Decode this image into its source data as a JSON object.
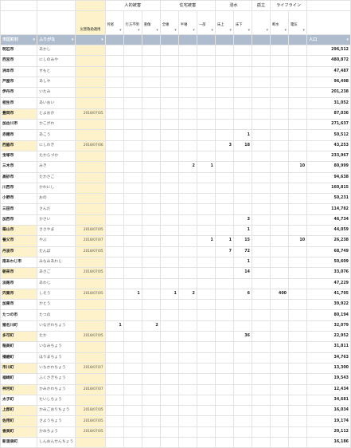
{
  "headers": {
    "groups": [
      "人的被害",
      "住宅被害",
      "浸水",
      "孤立",
      "ライフライン"
    ],
    "sub": [
      "死者",
      "行方不明",
      "重傷",
      "全壊",
      "半壊",
      "一部",
      "床上",
      "床下",
      "",
      "断水",
      "電気"
    ],
    "saigai_label": "災害救助適用",
    "city_col": "市区町村",
    "kana_col": "ふりがな",
    "pop_col": "人口"
  },
  "rows": [
    {
      "city": "明石市",
      "kana": "あかし",
      "date": "",
      "vals": [
        "",
        "",
        "",
        "",
        "",
        "",
        "",
        "",
        "",
        "",
        ""
      ],
      "pop": "296,512"
    },
    {
      "city": "西宮市",
      "kana": "にしのみや",
      "date": "",
      "vals": [
        "",
        "",
        "",
        "",
        "",
        "",
        "",
        "",
        "",
        "",
        ""
      ],
      "pop": "480,872"
    },
    {
      "city": "洲本市",
      "kana": "すもと",
      "date": "",
      "vals": [
        "",
        "",
        "",
        "",
        "",
        "",
        "",
        "",
        "",
        "",
        ""
      ],
      "pop": "47,487"
    },
    {
      "city": "芦屋市",
      "kana": "あしや",
      "date": "",
      "vals": [
        "",
        "",
        "",
        "",
        "",
        "",
        "",
        "",
        "",
        "",
        ""
      ],
      "pop": "96,498"
    },
    {
      "city": "伊丹市",
      "kana": "いたみ",
      "date": "",
      "vals": [
        "",
        "",
        "",
        "",
        "",
        "",
        "",
        "",
        "",
        "",
        ""
      ],
      "pop": "201,238"
    },
    {
      "city": "相生市",
      "kana": "あいおい",
      "date": "",
      "vals": [
        "",
        "",
        "",
        "",
        "",
        "",
        "",
        "",
        "",
        "",
        ""
      ],
      "pop": "31,052"
    },
    {
      "city": "豊岡市",
      "kana": "とよおか",
      "date": "2018/07/05",
      "vals": [
        "",
        "",
        "",
        "",
        "",
        "",
        "",
        "",
        "",
        "",
        ""
      ],
      "pop": "87,036"
    },
    {
      "city": "加古川市",
      "kana": "かこがわ",
      "date": "",
      "vals": [
        "",
        "",
        "",
        "",
        "",
        "",
        "",
        "",
        "",
        "",
        ""
      ],
      "pop": "271,637"
    },
    {
      "city": "赤穂市",
      "kana": "あこう",
      "date": "",
      "vals": [
        "",
        "",
        "",
        "",
        "",
        "",
        "",
        "1",
        "",
        "",
        ""
      ],
      "pop": "50,512"
    },
    {
      "city": "西脇市",
      "kana": "にしわき",
      "date": "2018/07/06",
      "vals": [
        "",
        "",
        "",
        "",
        "",
        "",
        "3",
        "18",
        "",
        "",
        ""
      ],
      "pop": "43,253"
    },
    {
      "city": "宝塚市",
      "kana": "たからづか",
      "date": "",
      "vals": [
        "",
        "",
        "",
        "",
        "",
        "",
        "",
        "",
        "",
        "",
        ""
      ],
      "pop": "233,967"
    },
    {
      "city": "三木市",
      "kana": "みき",
      "date": "",
      "vals": [
        "",
        "",
        "",
        "",
        "2",
        "1",
        "",
        "",
        "",
        "",
        "10"
      ],
      "pop": "80,999"
    },
    {
      "city": "高砂市",
      "kana": "たかさご",
      "date": "",
      "vals": [
        "",
        "",
        "",
        "",
        "",
        "",
        "",
        "",
        "",
        "",
        ""
      ],
      "pop": "94,638"
    },
    {
      "city": "川西市",
      "kana": "かわにし",
      "date": "",
      "vals": [
        "",
        "",
        "",
        "",
        "",
        "",
        "",
        "",
        "",
        "",
        ""
      ],
      "pop": "160,815"
    },
    {
      "city": "小野市",
      "kana": "おの",
      "date": "",
      "vals": [
        "",
        "",
        "",
        "",
        "",
        "",
        "",
        "",
        "",
        "",
        ""
      ],
      "pop": "50,231"
    },
    {
      "city": "三田市",
      "kana": "さんだ",
      "date": "",
      "vals": [
        "",
        "",
        "",
        "",
        "",
        "",
        "",
        "",
        "",
        "",
        ""
      ],
      "pop": "114,782"
    },
    {
      "city": "加西市",
      "kana": "かさい",
      "date": "",
      "vals": [
        "",
        "",
        "",
        "",
        "",
        "",
        "",
        "3",
        "",
        "",
        ""
      ],
      "pop": "46,734"
    },
    {
      "city": "篠山市",
      "kana": "ささやま",
      "date": "2018/07/05",
      "vals": [
        "",
        "",
        "",
        "",
        "",
        "",
        "",
        "1",
        "",
        "",
        ""
      ],
      "pop": "44,059"
    },
    {
      "city": "養父市",
      "kana": "やぶ",
      "date": "2018/07/07",
      "vals": [
        "",
        "",
        "",
        "",
        "",
        "1",
        "1",
        "15",
        "",
        "",
        "10"
      ],
      "pop": "26,238"
    },
    {
      "city": "丹波市",
      "kana": "たんば",
      "date": "2018/07/05",
      "vals": [
        "",
        "",
        "",
        "",
        "",
        "",
        "7",
        "72",
        "",
        "",
        ""
      ],
      "pop": "68,749"
    },
    {
      "city": "南あわじ市",
      "kana": "みなみあわじ",
      "date": "",
      "vals": [
        "",
        "",
        "",
        "",
        "",
        "",
        "",
        "1",
        "",
        "",
        ""
      ],
      "pop": "50,609"
    },
    {
      "city": "朝来市",
      "kana": "あさご",
      "date": "2018/07/05",
      "vals": [
        "",
        "",
        "",
        "",
        "",
        "",
        "",
        "14",
        "",
        "",
        ""
      ],
      "pop": "33,076"
    },
    {
      "city": "淡路市",
      "kana": "あわじ",
      "date": "",
      "vals": [
        "",
        "",
        "",
        "",
        "",
        "",
        "",
        "",
        "",
        "",
        ""
      ],
      "pop": "47,229"
    },
    {
      "city": "宍粟市",
      "kana": "しそう",
      "date": "2018/07/05",
      "vals": [
        "",
        "1",
        "",
        "1",
        "2",
        "",
        "",
        "6",
        "",
        "400",
        ""
      ],
      "pop": "41,795"
    },
    {
      "city": "加東市",
      "kana": "かとう",
      "date": "",
      "vals": [
        "",
        "",
        "",
        "",
        "",
        "",
        "",
        "",
        "",
        "",
        ""
      ],
      "pop": "39,922"
    },
    {
      "city": "たつの市",
      "kana": "たつの",
      "date": "",
      "vals": [
        "",
        "",
        "",
        "",
        "",
        "",
        "",
        "",
        "",
        "",
        ""
      ],
      "pop": "80,194"
    },
    {
      "city": "猪名川町",
      "kana": "いながわちょう",
      "date": "",
      "vals": [
        "1",
        "",
        "2",
        "",
        "",
        "",
        "",
        "",
        "",
        "",
        ""
      ],
      "pop": "32,079"
    },
    {
      "city": "多可町",
      "kana": "たか",
      "date": "2018/07/05",
      "vals": [
        "",
        "",
        "",
        "",
        "",
        "",
        "",
        "36",
        "",
        "",
        ""
      ],
      "pop": "22,952"
    },
    {
      "city": "稲美町",
      "kana": "いなみちょう",
      "date": "",
      "vals": [
        "",
        "",
        "",
        "",
        "",
        "",
        "",
        "",
        "",
        "",
        ""
      ],
      "pop": "31,811"
    },
    {
      "city": "播磨町",
      "kana": "はりまちょう",
      "date": "",
      "vals": [
        "",
        "",
        "",
        "",
        "",
        "",
        "",
        "",
        "",
        "",
        ""
      ],
      "pop": "34,763"
    },
    {
      "city": "市川町",
      "kana": "いちかわちょう",
      "date": "2018/07/07",
      "vals": [
        "",
        "",
        "",
        "",
        "",
        "",
        "",
        "",
        "",
        "",
        ""
      ],
      "pop": "13,300"
    },
    {
      "city": "福崎町",
      "kana": "ふくさきちょう",
      "date": "",
      "vals": [
        "",
        "",
        "",
        "",
        "",
        "",
        "",
        "",
        "",
        "",
        ""
      ],
      "pop": "19,543"
    },
    {
      "city": "神河町",
      "kana": "かみかわちょう",
      "date": "2018/07/07",
      "vals": [
        "",
        "",
        "",
        "",
        "",
        "",
        "",
        "",
        "",
        "",
        ""
      ],
      "pop": "12,434"
    },
    {
      "city": "太子町",
      "kana": "たいしちょう",
      "date": "",
      "vals": [
        "",
        "",
        "",
        "",
        "",
        "",
        "",
        "",
        "",
        "",
        ""
      ],
      "pop": "34,681"
    },
    {
      "city": "上郡町",
      "kana": "かみごおりちょう",
      "date": "2018/07/05",
      "vals": [
        "",
        "",
        "",
        "",
        "",
        "",
        "",
        "",
        "",
        "",
        ""
      ],
      "pop": "16,034"
    },
    {
      "city": "佐用町",
      "kana": "さようちょう",
      "date": "2018/07/05",
      "vals": [
        "",
        "",
        "",
        "",
        "",
        "",
        "",
        "",
        "",
        "",
        ""
      ],
      "pop": "19,174"
    },
    {
      "city": "香美町",
      "kana": "かみちょう",
      "date": "2018/07/05",
      "vals": [
        "",
        "",
        "",
        "",
        "",
        "",
        "",
        "",
        "",
        "",
        ""
      ],
      "pop": "20,112"
    },
    {
      "city": "新温泉町",
      "kana": "しんおんせんちょう",
      "date": "",
      "vals": [
        "",
        "",
        "",
        "",
        "",
        "",
        "",
        "",
        "",
        "",
        ""
      ],
      "pop": "16,186"
    }
  ]
}
